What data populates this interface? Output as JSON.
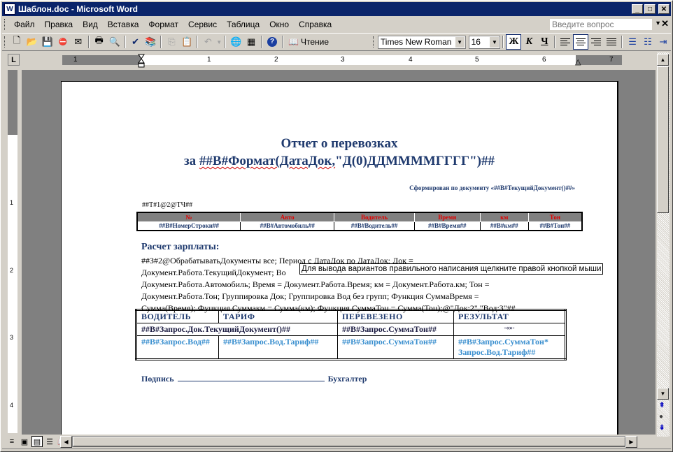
{
  "window": {
    "title": "Шаблон.doc - Microsoft Word",
    "controls": {
      "minimize": "_",
      "maximize": "□",
      "close": "✕"
    }
  },
  "menubar": {
    "items": [
      {
        "label": "Файл"
      },
      {
        "label": "Правка"
      },
      {
        "label": "Вид"
      },
      {
        "label": "Вставка"
      },
      {
        "label": "Формат"
      },
      {
        "label": "Сервис"
      },
      {
        "label": "Таблица"
      },
      {
        "label": "Окно"
      },
      {
        "label": "Справка"
      }
    ],
    "ask_placeholder": "Введите вопрос",
    "doc_close": "✕"
  },
  "toolbar": {
    "read_label": "Чтение",
    "font_name": "Times New Roman",
    "font_size": "16",
    "bold": "Ж",
    "italic": "К",
    "underline": "Ч",
    "icons": {
      "new": "🗋",
      "open": "📂",
      "save": "💾",
      "permission": "⛔",
      "email": "✉",
      "print": "🖶",
      "preview": "🔍",
      "spelling": "✔",
      "research": "📚",
      "copy": "⎘",
      "paste": "📋",
      "undo": "↶",
      "hyperlink": "🌐",
      "table": "▦",
      "help": "?"
    }
  },
  "ruler": {
    "numbers": [
      "1",
      "1",
      "2",
      "3",
      "4",
      "5",
      "6",
      "7"
    ],
    "vertical_numbers": [
      "1",
      "2",
      "3",
      "4"
    ]
  },
  "document": {
    "title_line1": "Отчет о перевозках",
    "title_line2_prefix": "за ",
    "title_line2_field": "##В#Формат(ДатаДок,",
    "title_line2_suffix": "\"Д(0)ДДММММГГГГ\")##",
    "formed_by": "Сформирован по документу «##В#ТекущийДокумент()##»",
    "table_marker": "##Т#1@2@ТЧ##",
    "table1": {
      "headers": [
        "№",
        "Авто",
        "Водитель",
        "Время",
        "км",
        "Тон"
      ],
      "row": [
        "##В#НомерСтроки##",
        "##В#Автомобиль##",
        "##В#Водитель##",
        "##В#Время##",
        "##В#км##",
        "##В#Тон##"
      ]
    },
    "section_heading": "Расчет зарплаты:",
    "query_lines": [
      "##З#2@ОбрабатыватьДокументы все; Период с ДатаДок по ДатаДок; Док =",
      "Документ.Работа.ТекущийДокумент; Во",
      "Документ.Работа.Автомобиль; Время = Документ.Работа.Время; км = Документ.Работа.км; Тон =",
      "Документ.Работа.Тон; Группировка Док; Группировка Вод без групп; Функция СуммаВремя =",
      "Сумма(Время); Функция Суммакм = Сумма(км); Функция СуммаТон = Сумма(Тон);@\"Док:2\",\"Вод:3\"##"
    ],
    "tooltip": "Для вывода вариантов правильного написания щелкните правой кнопкой мыши",
    "table2": {
      "headers": [
        "ВОДИТЕЛЬ",
        "ТАРИФ",
        "ПЕРЕВЕЗЕНО",
        "РЕЗУЛЬТАТ"
      ],
      "row1": [
        "##В#Запрос.Док.ТекущийДокумент()##",
        "##В#Запрос.СуммаТон##",
        "-«»-"
      ],
      "row2": [
        "##В#Запрос.Вод##",
        "##В#Запрос.Вод.Тариф##",
        "##В#Запрос.СуммаТон##",
        "##В#Запрос.СуммаТон* Запрос.Вод.Тариф##"
      ]
    },
    "sign_label": "Подпись",
    "sign_role": "Бухгалтер"
  },
  "colors": {
    "titlebar": "#0a246a",
    "heading_text": "#1f3a6e",
    "table_header_text": "#e00000",
    "row2_text": "#3a8fcf"
  }
}
